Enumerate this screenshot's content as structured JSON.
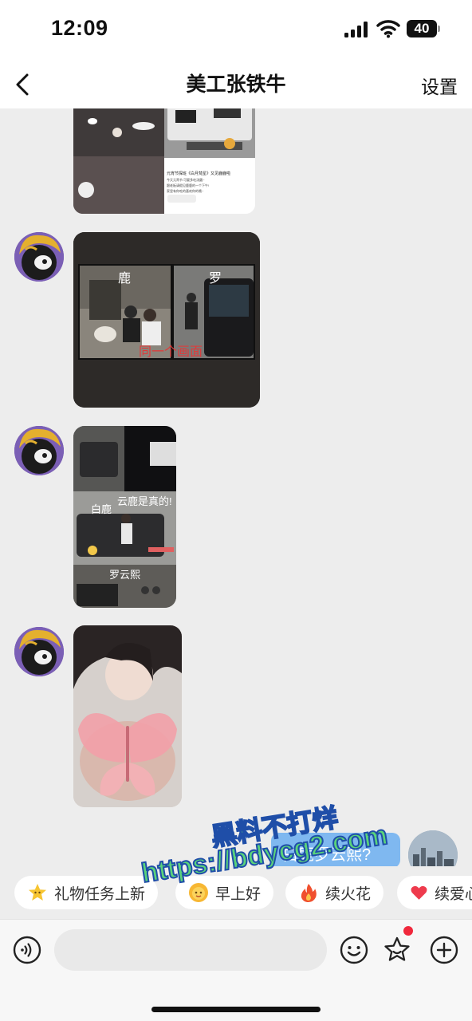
{
  "status_bar": {
    "time": "12:09",
    "battery": "40"
  },
  "header": {
    "title": "美工张铁牛",
    "settings_label": "设置"
  },
  "messages": {
    "m1": {
      "caption": "元宵节探班《白月梵星》又见鹿鹿啦",
      "caption2": "今天元宵节 可要多吃汤圆~",
      "caption3": "跟老板请假见鹿鹿的一个下午!",
      "caption4": "家里有你吃的喜欢你的哦~"
    },
    "m2": {
      "label_left": "鹿",
      "label_right": "罗",
      "overlay": "同一个画面"
    },
    "m3": {
      "label_a": "白鹿",
      "label_b": "云鹿是真的!",
      "label_c": "罗云熙"
    },
    "m5": {
      "text": "白鹿罗云熙?"
    }
  },
  "quick_replies": [
    {
      "label": "礼物任务上新",
      "icon": "star-face-icon"
    },
    {
      "label": "早上好",
      "icon": "sun-face-icon"
    },
    {
      "label": "续火花",
      "icon": "fire-icon"
    },
    {
      "label": "续爱心",
      "icon": "heart-icon"
    }
  ],
  "input": {
    "placeholder": ""
  },
  "watermark": {
    "line1": "黑料不打烊",
    "line2": "https://bdycg2.com"
  }
}
